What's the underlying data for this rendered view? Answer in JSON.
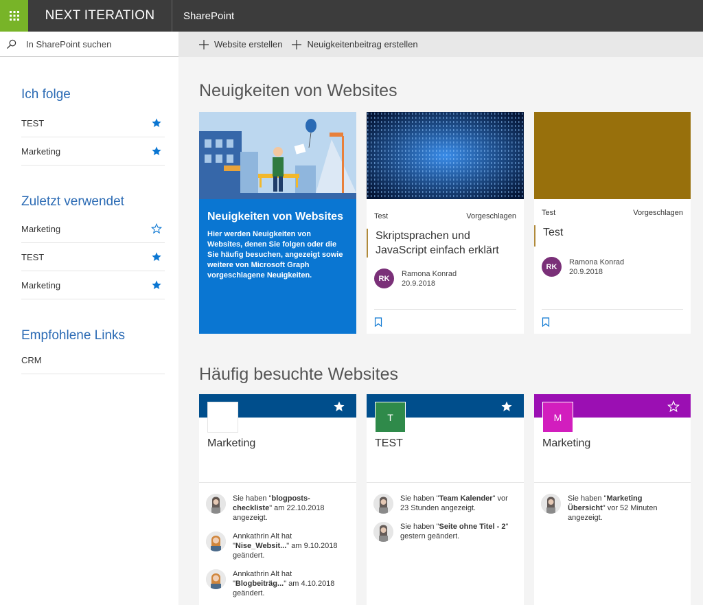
{
  "colors": {
    "brand_green": "#78b428",
    "topbar": "#3c3c3c",
    "accent_blue": "#0a76d2",
    "heading_blue": "#2a6ab4",
    "site_blue": "#004e8c",
    "site_purple": "#9b0fb3",
    "tile_green": "#2f8a4a",
    "tile_magenta": "#d21ebe",
    "news_gold": "#98700c",
    "avatar_purple": "#7a3078"
  },
  "topbar": {
    "brand": "NEXT ITERATION",
    "app": "SharePoint"
  },
  "search": {
    "placeholder": "In SharePoint suchen"
  },
  "commands": [
    {
      "label": "Website erstellen",
      "icon": "plus-icon"
    },
    {
      "label": "Neuigkeitenbeitrag erstellen",
      "icon": "plus-icon"
    }
  ],
  "nav": {
    "following": {
      "title": "Ich folge",
      "items": [
        {
          "label": "TEST",
          "starred": true
        },
        {
          "label": "Marketing",
          "starred": true
        }
      ]
    },
    "recent": {
      "title": "Zuletzt verwendet",
      "items": [
        {
          "label": "Marketing",
          "starred": false
        },
        {
          "label": "TEST",
          "starred": true
        },
        {
          "label": "Marketing",
          "starred": true
        }
      ]
    },
    "links": {
      "title": "Empfohlene Links",
      "items": [
        {
          "label": "CRM"
        }
      ]
    }
  },
  "news": {
    "title": "Neuigkeiten von Websites",
    "featured": {
      "title": "Neuigkeiten von Websites",
      "description": "Hier werden Neuigkeiten von Websites, denen Sie folgen oder die Sie häufig besuchen, angezeigt sowie weitere von Microsoft Graph vorgeschlagene Neuigkeiten."
    },
    "cards": [
      {
        "site": "Test",
        "tag": "Vorgeschlagen",
        "title": "Skriptsprachen und JavaScript einfach erklärt",
        "initials": "RK",
        "author": "Ramona Konrad",
        "date": "20.9.2018"
      },
      {
        "site": "Test",
        "tag": "Vorgeschlagen",
        "title": "Test",
        "initials": "RK",
        "author": "Ramona Konrad",
        "date": "20.9.2018"
      }
    ]
  },
  "frequent": {
    "title": "Häufig besuchte Websites",
    "sites": [
      {
        "name": "Marketing",
        "logo": "",
        "starred": true,
        "activities": [
          {
            "pre": "Sie haben \"",
            "bold": "blogposts-checkliste",
            "post": "\" am 22.10.2018 angezeigt."
          },
          {
            "pre": "Annkathrin Alt hat \"",
            "bold": "Nise_Websit...",
            "post": "\" am 9.10.2018 geändert."
          },
          {
            "pre": "Annkathrin Alt hat \"",
            "bold": "Blogbeiträg...",
            "post": "\" am 4.10.2018 geändert."
          }
        ]
      },
      {
        "name": "TEST",
        "logo": "T",
        "starred": true,
        "activities": [
          {
            "pre": "Sie haben \"",
            "bold": "Team Kalender",
            "post": "\" vor 23 Stunden angezeigt."
          },
          {
            "pre": "Sie haben \"",
            "bold": "Seite ohne Titel - 2",
            "post": "\" gestern geändert."
          }
        ]
      },
      {
        "name": "Marketing",
        "logo": "M",
        "starred": false,
        "activities": [
          {
            "pre": "Sie haben \"",
            "bold": "Marketing Übersicht",
            "post": "\" vor 52 Minuten angezeigt."
          }
        ]
      }
    ]
  }
}
